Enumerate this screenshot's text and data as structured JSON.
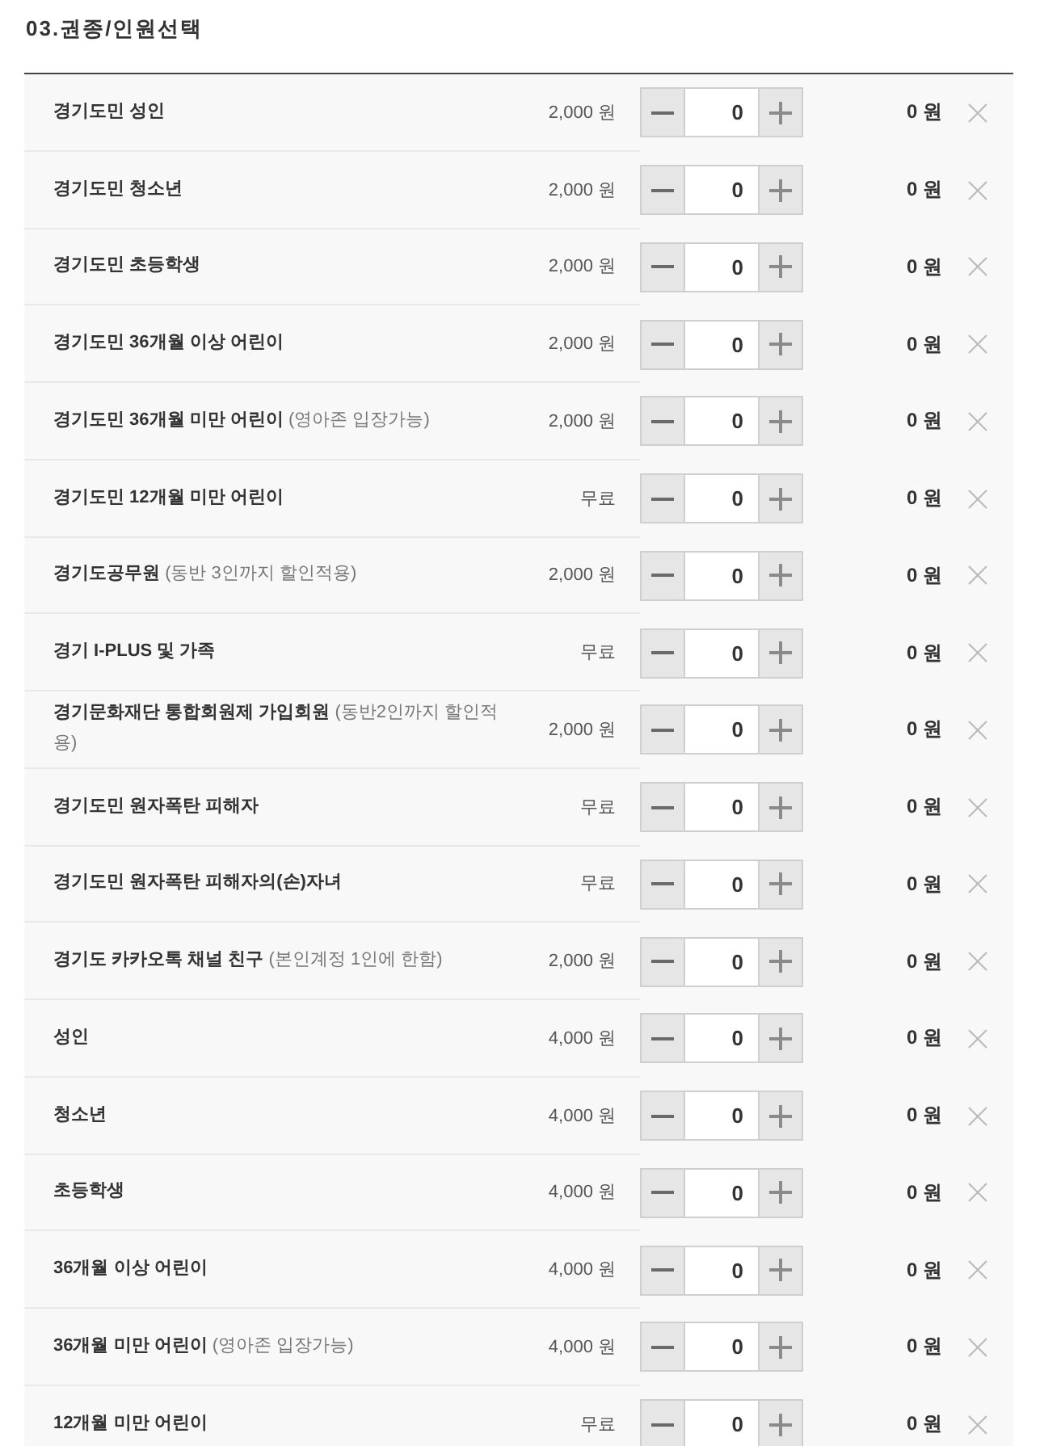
{
  "section_title": "03.권종/인원선택",
  "tickets": [
    {
      "name": "경기도민 성인",
      "price": "2,000 원",
      "quantity": "0",
      "total": "0 원"
    },
    {
      "name": "경기도민 청소년",
      "price": "2,000 원",
      "quantity": "0",
      "total": "0 원"
    },
    {
      "name": "경기도민 초등학생",
      "price": "2,000 원",
      "quantity": "0",
      "total": "0 원"
    },
    {
      "name": "경기도민 36개월 이상 어린이",
      "price": "2,000 원",
      "quantity": "0",
      "total": "0 원"
    },
    {
      "name": "경기도민 36개월 미만 어린이",
      "note": "(영아존 입장가능)",
      "price": "2,000 원",
      "quantity": "0",
      "total": "0 원"
    },
    {
      "name": "경기도민 12개월 미만 어린이",
      "price": "무료",
      "quantity": "0",
      "total": "0 원"
    },
    {
      "name": "경기도공무원",
      "note": "(동반 3인까지 할인적용)",
      "price": "2,000 원",
      "quantity": "0",
      "total": "0 원"
    },
    {
      "name": "경기 I-PLUS 및 가족",
      "price": "무료",
      "quantity": "0",
      "total": "0 원"
    },
    {
      "name": "경기문화재단 통합회원제 가입회원",
      "note": "(동반2인까지 할인적용)",
      "price": "2,000 원",
      "quantity": "0",
      "total": "0 원"
    },
    {
      "name": "경기도민 원자폭탄 피해자",
      "price": "무료",
      "quantity": "0",
      "total": "0 원"
    },
    {
      "name": "경기도민 원자폭탄 피해자의(손)자녀",
      "price": "무료",
      "quantity": "0",
      "total": "0 원"
    },
    {
      "name": "경기도 카카오톡 채널 친구",
      "note": "(본인계정 1인에 한함)",
      "price": "2,000 원",
      "quantity": "0",
      "total": "0 원"
    },
    {
      "name": "성인",
      "price": "4,000 원",
      "quantity": "0",
      "total": "0 원"
    },
    {
      "name": "청소년",
      "price": "4,000 원",
      "quantity": "0",
      "total": "0 원"
    },
    {
      "name": "초등학생",
      "price": "4,000 원",
      "quantity": "0",
      "total": "0 원"
    },
    {
      "name": "36개월 이상 어린이",
      "price": "4,000 원",
      "quantity": "0",
      "total": "0 원"
    },
    {
      "name": "36개월 미만 어린이",
      "note": "(영아존 입장가능)",
      "price": "4,000 원",
      "quantity": "0",
      "total": "0 원"
    },
    {
      "name": "12개월 미만 어린이",
      "price": "무료",
      "quantity": "0",
      "total": "0 원"
    }
  ]
}
